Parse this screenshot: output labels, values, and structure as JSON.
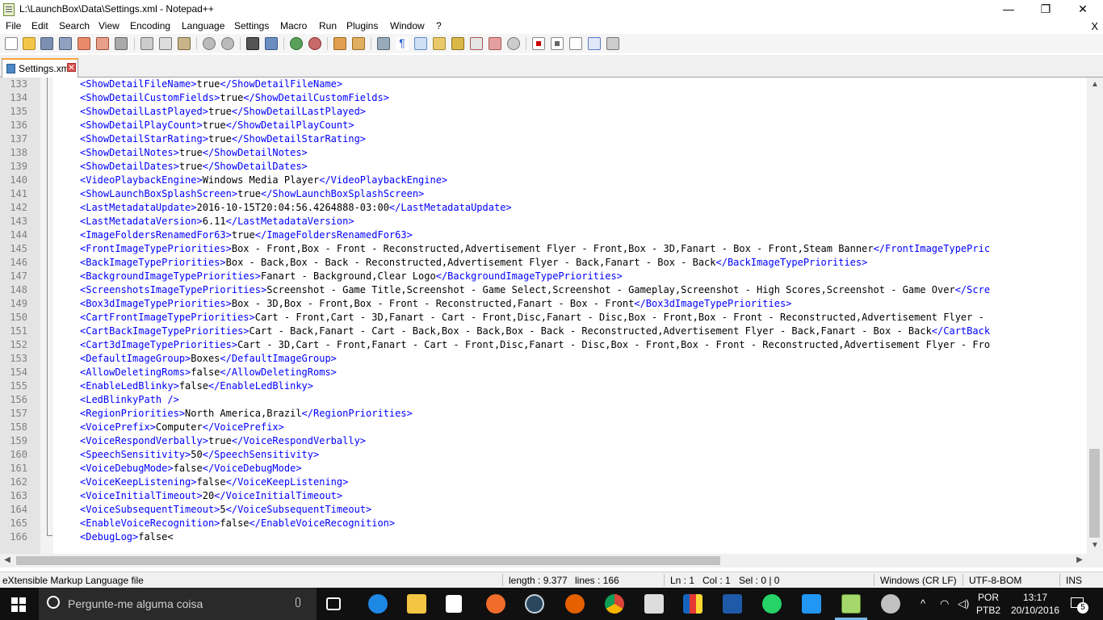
{
  "window": {
    "title": "L:\\LaunchBox\\Data\\Settings.xml - Notepad++",
    "minimize": "—",
    "maximize": "❐",
    "close": "✕"
  },
  "menu": {
    "items": [
      "File",
      "Edit",
      "Search",
      "View",
      "Encoding",
      "Language",
      "Settings",
      "Macro",
      "Run",
      "Plugins",
      "Window",
      "?"
    ],
    "close": "X"
  },
  "tab": {
    "label": "Settings.xml",
    "close": "✕"
  },
  "editor": {
    "lines": [
      {
        "n": "133",
        "tag": "ShowDetailFileName",
        "val": "true"
      },
      {
        "n": "134",
        "tag": "ShowDetailCustomFields",
        "val": "true"
      },
      {
        "n": "135",
        "tag": "ShowDetailLastPlayed",
        "val": "true"
      },
      {
        "n": "136",
        "tag": "ShowDetailPlayCount",
        "val": "true"
      },
      {
        "n": "137",
        "tag": "ShowDetailStarRating",
        "val": "true"
      },
      {
        "n": "138",
        "tag": "ShowDetailNotes",
        "val": "true"
      },
      {
        "n": "139",
        "tag": "ShowDetailDates",
        "val": "true"
      },
      {
        "n": "140",
        "tag": "VideoPlaybackEngine",
        "val": "Windows Media Player"
      },
      {
        "n": "141",
        "tag": "ShowLaunchBoxSplashScreen",
        "val": "true"
      },
      {
        "n": "142",
        "tag": "LastMetadataUpdate",
        "val": "2016-10-15T20:04:56.4264888-03:00"
      },
      {
        "n": "143",
        "tag": "LastMetadataVersion",
        "val": "6.11"
      },
      {
        "n": "144",
        "tag": "ImageFoldersRenamedFor63",
        "val": "true"
      },
      {
        "n": "145",
        "tag": "FrontImageTypePriorities",
        "val": "Box - Front,Box - Front - Reconstructed,Advertisement Flyer - Front,Box - 3D,Fanart - Box - Front,Steam Banner",
        "close": "</FrontImageTypePric"
      },
      {
        "n": "146",
        "tag": "BackImageTypePriorities",
        "val": "Box - Back,Box - Back - Reconstructed,Advertisement Flyer - Back,Fanart - Box - Back"
      },
      {
        "n": "147",
        "tag": "BackgroundImageTypePriorities",
        "val": "Fanart - Background,Clear Logo"
      },
      {
        "n": "148",
        "tag": "ScreenshotsImageTypePriorities",
        "val": "Screenshot - Game Title,Screenshot - Game Select,Screenshot - Gameplay,Screenshot - High Scores,Screenshot - Game Over",
        "close": "</Scre"
      },
      {
        "n": "149",
        "tag": "Box3dImageTypePriorities",
        "val": "Box - 3D,Box - Front,Box - Front - Reconstructed,Fanart - Box - Front"
      },
      {
        "n": "150",
        "tag": "CartFrontImageTypePriorities",
        "val": "Cart - Front,Cart - 3D,Fanart - Cart - Front,Disc,Fanart - Disc,Box - Front,Box - Front - Reconstructed,Advertisement Flyer -",
        "close": ""
      },
      {
        "n": "151",
        "tag": "CartBackImageTypePriorities",
        "val": "Cart - Back,Fanart - Cart - Back,Box - Back,Box - Back - Reconstructed,Advertisement Flyer - Back,Fanart - Box - Back",
        "close": "</CartBack"
      },
      {
        "n": "152",
        "tag": "Cart3dImageTypePriorities",
        "val": "Cart - 3D,Cart - Front,Fanart - Cart - Front,Disc,Fanart - Disc,Box - Front,Box - Front - Reconstructed,Advertisement Flyer - Fro",
        "close": ""
      },
      {
        "n": "153",
        "tag": "DefaultImageGroup",
        "val": "Boxes"
      },
      {
        "n": "154",
        "tag": "AllowDeletingRoms",
        "val": "false"
      },
      {
        "n": "155",
        "tag": "EnableLedBlinky",
        "val": "false"
      },
      {
        "n": "156",
        "raw": "<LedBlinkyPath />"
      },
      {
        "n": "157",
        "tag": "RegionPriorities",
        "val": "North America,Brazil"
      },
      {
        "n": "158",
        "tag": "VoicePrefix",
        "val": "Computer"
      },
      {
        "n": "159",
        "tag": "VoiceRespondVerbally",
        "val": "true"
      },
      {
        "n": "160",
        "tag": "SpeechSensitivity",
        "val": "50"
      },
      {
        "n": "161",
        "tag": "VoiceDebugMode",
        "val": "false"
      },
      {
        "n": "162",
        "tag": "VoiceKeepListening",
        "val": "false"
      },
      {
        "n": "163",
        "tag": "VoiceInitialTimeout",
        "val": "20"
      },
      {
        "n": "164",
        "tag": "VoiceSubsequentTimeout",
        "val": "5"
      },
      {
        "n": "165",
        "tag": "EnableVoiceRecognition",
        "val": "false"
      },
      {
        "n": "166",
        "tag": "DebugLog",
        "val": "false<",
        "close": "",
        "noclose": true
      }
    ]
  },
  "status": {
    "filetype": "eXtensible Markup Language file",
    "length": "length : 9.377",
    "lines": "lines : 166",
    "ln": "Ln : 1",
    "col": "Col : 1",
    "sel": "Sel : 0 | 0",
    "eol": "Windows (CR LF)",
    "encoding": "UTF-8-BOM",
    "mode": "INS"
  },
  "taskbar": {
    "search_placeholder": "Pergunte-me alguma coisa",
    "lang_top": "POR",
    "lang_bottom": "PTB2",
    "time": "13:17",
    "date": "20/10/2016",
    "notif_count": "5"
  }
}
